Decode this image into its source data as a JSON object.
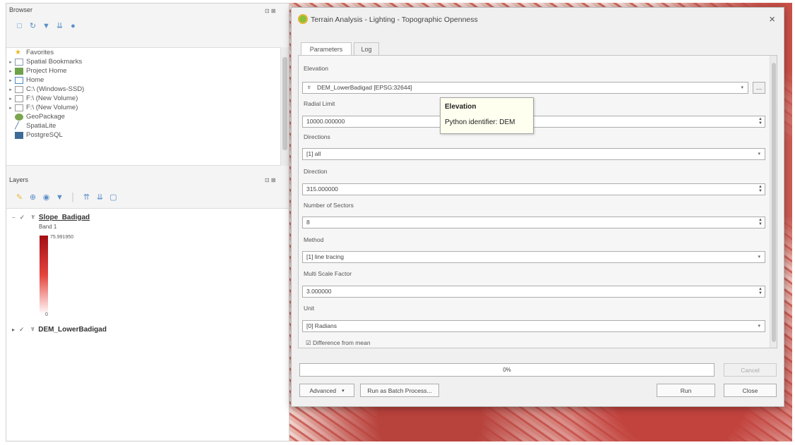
{
  "browser_panel": {
    "title": "Browser",
    "controls": "⊡ ⊠",
    "toolbar_icons": [
      "add-icon",
      "refresh-icon",
      "filter-icon",
      "collapse-icon",
      "info-icon"
    ],
    "items": [
      {
        "label": "Favorites",
        "icon": "star-icon",
        "expandable": false
      },
      {
        "label": "Spatial Bookmarks",
        "icon": "bookmark-icon",
        "expandable": true
      },
      {
        "label": "Project Home",
        "icon": "project-icon",
        "expandable": true
      },
      {
        "label": "Home",
        "icon": "home-icon",
        "expandable": true
      },
      {
        "label": "C:\\ (Windows-SSD)",
        "icon": "drive-icon",
        "expandable": true
      },
      {
        "label": "F:\\ (New Volume)",
        "icon": "drive-icon",
        "expandable": true
      },
      {
        "label": "F:\\ (New Volume)",
        "icon": "drive-icon",
        "expandable": true
      },
      {
        "label": "GeoPackage",
        "icon": "geopackage-icon",
        "expandable": false
      },
      {
        "label": "SpatiaLite",
        "icon": "spatialite-icon",
        "expandable": false
      },
      {
        "label": "PostgreSQL",
        "icon": "postgresql-icon",
        "expandable": false
      }
    ]
  },
  "layers_panel": {
    "title": "Layers",
    "controls": "⊡ ⊠",
    "toolbar_icons": [
      "style-icon",
      "add-layer-icon",
      "visibility-icon",
      "filter-icon",
      "expand-icon",
      "collapse-icon",
      "remove-icon"
    ],
    "layer1": {
      "name": "Slope_Badigad",
      "band": "Band 1",
      "max": "75.991950",
      "min": "0",
      "checked": true
    },
    "layer2": {
      "name": "DEM_LowerBadigad",
      "checked": true
    }
  },
  "dialog": {
    "title": "Terrain Analysis - Lighting - Topographic Openness",
    "tabs": [
      "Parameters",
      "Log"
    ],
    "elevation_label": "Elevation",
    "elevation_value": "DEM_LowerBadigad [EPSG:32644]",
    "radial_limit_label": "Radial Limit",
    "radial_limit_value": "10000.000000",
    "directions_label": "Directions",
    "directions_value": "[1] all",
    "direction_label": "Direction",
    "direction_value": "315.000000",
    "sectors_label": "Number of Sectors",
    "sectors_value": "8",
    "method_label": "Method",
    "method_value": "[1] line tracing",
    "msf_label": "Multi Scale Factor",
    "msf_value": "3.000000",
    "unit_label": "Unit",
    "unit_value": "[0] Radians",
    "cutoff_checkbox": "Difference from mean",
    "progress": "0%",
    "tooltip_title": "Elevation",
    "tooltip_body": "Python identifier: DEM",
    "buttons": {
      "cancel": "Cancel",
      "advanced": "Advanced",
      "batch": "Run as Batch Process...",
      "run": "Run",
      "close": "Close"
    }
  },
  "colors": {
    "ramp_top": "#a30f15",
    "ramp_bottom": "#ffffff",
    "qgis_logo": "#8bbf3c"
  }
}
